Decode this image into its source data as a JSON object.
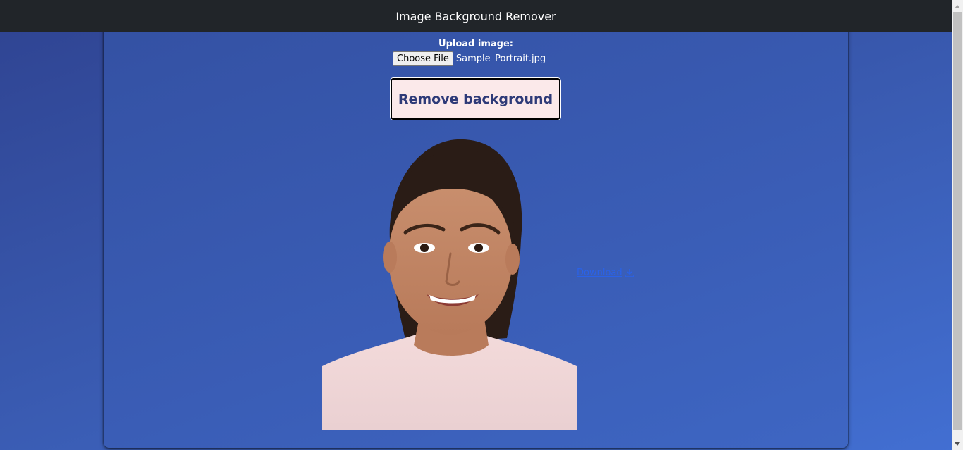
{
  "header": {
    "title": "Image Background Remover"
  },
  "upload": {
    "label": "Upload image:",
    "choose_file_label": "Choose File",
    "file_name": "Sample_Portrait.jpg"
  },
  "actions": {
    "remove_background_label": "Remove background",
    "download_label": "Download"
  },
  "icons": {
    "download": "download-icon",
    "scroll_up": "chevron-up-icon",
    "scroll_down": "chevron-down-icon"
  },
  "colors": {
    "header_bg": "#212529",
    "button_bg": "#fbe9ea",
    "button_text": "#2d3a78",
    "link": "#2a62e8",
    "panel_bg": "#3a5db6"
  }
}
